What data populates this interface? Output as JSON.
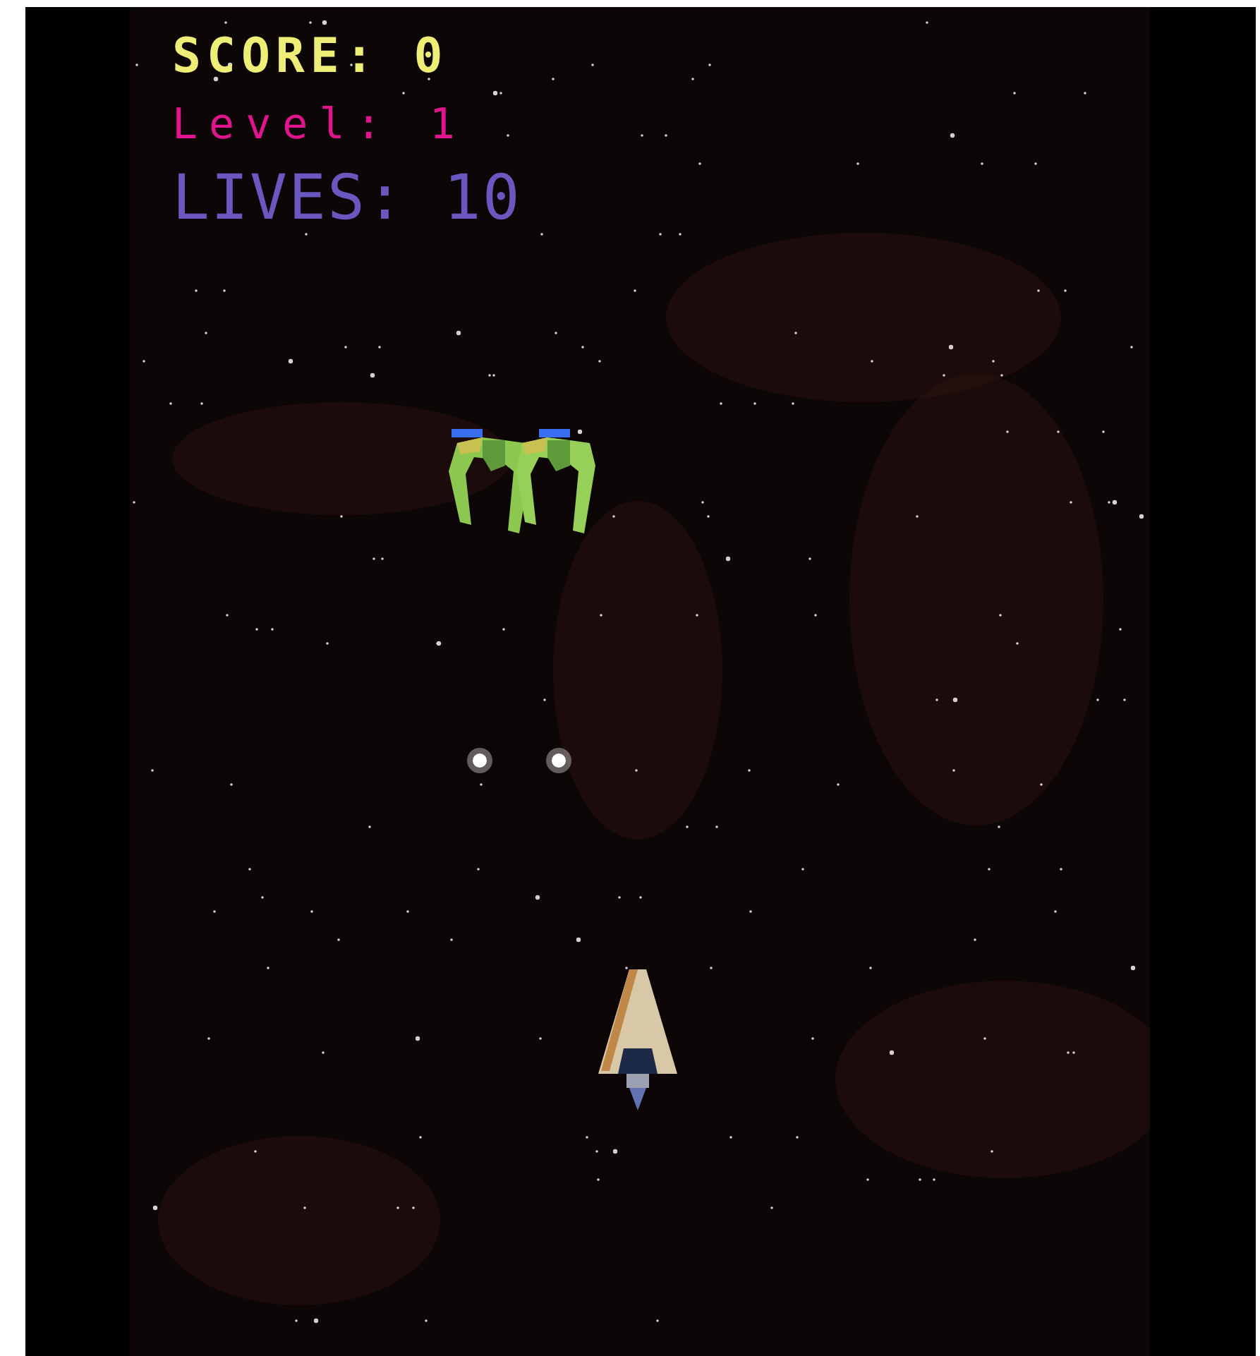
{
  "hud": [
    {
      "kind": "score",
      "text": "SCORE: 0"
    },
    {
      "kind": "level",
      "text": "Level: 1"
    },
    {
      "kind": "lives",
      "text": "LIVES: 10"
    }
  ]
}
